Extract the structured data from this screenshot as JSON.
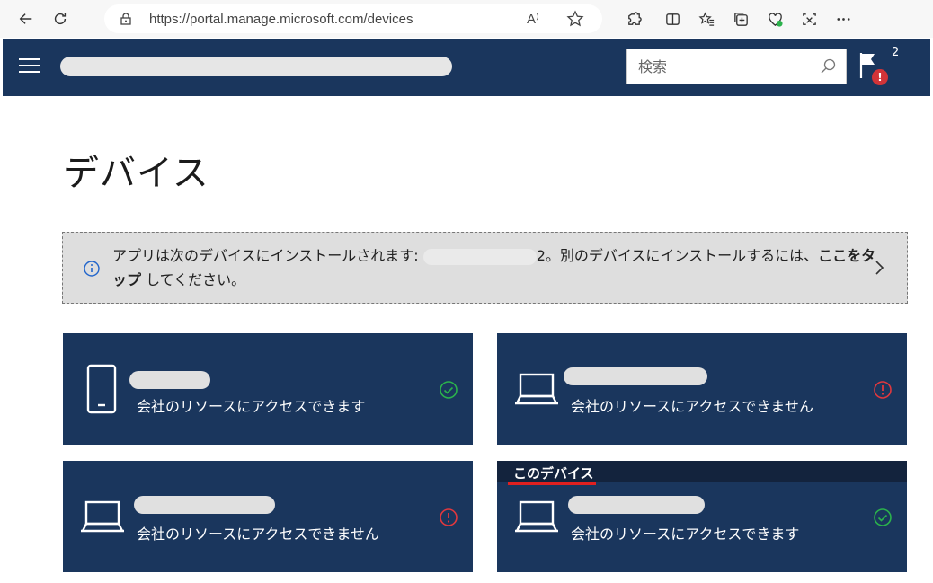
{
  "browser": {
    "url": "https://portal.manage.microsoft.com/devices",
    "read_aloud_label": "A⁾"
  },
  "header": {
    "search_placeholder": "検索",
    "notification_count": "2",
    "alert_badge": "!"
  },
  "page": {
    "title": "デバイス"
  },
  "banner": {
    "text_before": "アプリは次のデバイスにインストールされます: ",
    "text_partial": "2。別のデバイスにインストールするには、",
    "link": "ここをタップ",
    "text_after": " してください。"
  },
  "devices": [
    {
      "type": "phone",
      "status": "会社のリソースにアクセスできます",
      "state": "ok",
      "this_device": false
    },
    {
      "type": "laptop",
      "status": "会社のリソースにアクセスできません",
      "state": "error",
      "this_device": false
    },
    {
      "type": "laptop",
      "status": "会社のリソースにアクセスできません",
      "state": "error",
      "this_device": false
    },
    {
      "type": "laptop",
      "status": "会社のリソースにアクセスできます",
      "state": "ok",
      "this_device": true
    }
  ],
  "this_device_label": "このデバイス",
  "colors": {
    "header_bg": "#1a365d",
    "ok": "#2bb24c",
    "error": "#e0383e",
    "accent_underline": "#e02020"
  }
}
